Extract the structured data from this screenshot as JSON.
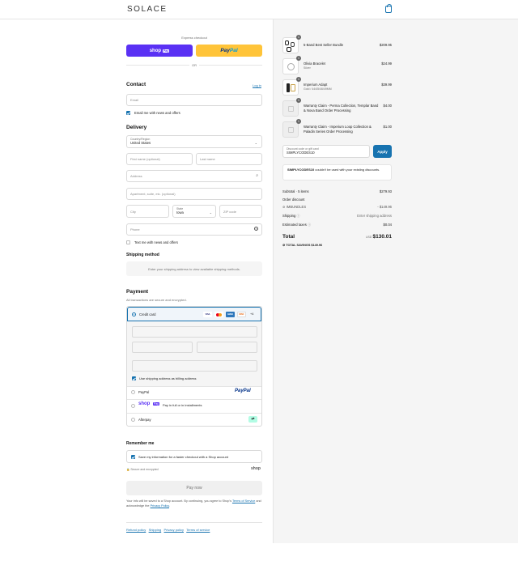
{
  "header": {
    "logo": "SOLACE",
    "cart_icon": "bag-icon"
  },
  "express": {
    "label": "Express checkout",
    "shop_label": "shop",
    "shop_badge": "Pay",
    "paypal_a": "Pay",
    "paypal_b": "Pal",
    "or": "OR"
  },
  "contact": {
    "title": "Contact",
    "login": "Log in",
    "email_placeholder": "Email",
    "news_label": "Email me with news and offers"
  },
  "delivery": {
    "title": "Delivery",
    "country_label": "Country/Region",
    "country_value": "United States",
    "first_name": "First name (optional)",
    "last_name": "Last name",
    "address": "Address",
    "apartment": "Apartment, suite, etc. (optional)",
    "city": "City",
    "state_label": "State",
    "state_value": "Iowa",
    "zip": "ZIP code",
    "phone": "Phone",
    "text_news": "Text me with news and offers"
  },
  "shipping": {
    "title": "Shipping method",
    "message": "Enter your shipping address to view available shipping methods."
  },
  "payment": {
    "title": "Payment",
    "subtitle": "All transactions are secure and encrypted.",
    "credit_card": "Credit card",
    "cards": [
      "VISA",
      "MC",
      "AMEX",
      "DISC"
    ],
    "more": "+4",
    "billing_same": "Use shipping address as billing address",
    "paypal": "PayPal",
    "shoppay_text": "Pay in full or in installments",
    "shoppay_logo": "shop",
    "shoppay_badge": "Pay",
    "afterpay": "Afterpay"
  },
  "remember": {
    "title": "Remember me",
    "save_label": "Save my information for a faster checkout with a Shop account",
    "secure": "Secure and encrypted",
    "shop_logo": "shop"
  },
  "pay_now": "Pay now",
  "legal": {
    "line1": "Your info will be saved to a Shop account. By continuing, you agree to Shop's",
    "terms": "Terms of Service",
    "and": "and acknowledge the",
    "privacy": "Privacy Policy",
    "dot": "."
  },
  "footer_links": [
    "Refund policy",
    "Shipping",
    "Privacy policy",
    "Terms of service"
  ],
  "items": [
    {
      "name": "5-Band Best Seller Bundle",
      "variant": "",
      "price": "$209.95",
      "qty": "1"
    },
    {
      "name": "Olivia Bracelet",
      "variant": "Silver",
      "price": "$24.99",
      "qty": "1"
    },
    {
      "name": "Imperium Adapt",
      "variant": "Gold / 44/45/46/49MM",
      "price": "$39.99",
      "qty": "1"
    },
    {
      "name": "Warranty Claim - Perma Collection, Templar Band & Nova Band Order Processing",
      "variant": "",
      "price": "$4.00",
      "qty": "1"
    },
    {
      "name": "Warranty Claim - Imperium Loop Collection & Paladin Series Order Processing",
      "variant": "",
      "price": "$1.00",
      "qty": "1"
    }
  ],
  "discount": {
    "label": "Discount code or gift card",
    "value": "SIMPLYCODES10",
    "apply": "Apply",
    "error_code": "SIMPLYCODES10",
    "error_text": "couldn't be used with your existing discounts."
  },
  "summary": {
    "subtotal_label": "Subtotal · 5 items",
    "subtotal": "$279.93",
    "order_discount": "Order discount",
    "code": "IMBUNDLES",
    "code_amount": "- $149.96",
    "shipping_label": "Shipping",
    "shipping_value": "Enter shipping address",
    "taxes_label": "Estimated taxes",
    "taxes_value": "$0.04",
    "total_label": "Total",
    "currency": "USD",
    "total": "$130.01",
    "savings_label": "TOTAL SAVINGS",
    "savings": "$149.96"
  },
  "colors": {
    "accent": "#1773b0",
    "shop": "#5a31f4",
    "paypal": "#ffc439"
  }
}
